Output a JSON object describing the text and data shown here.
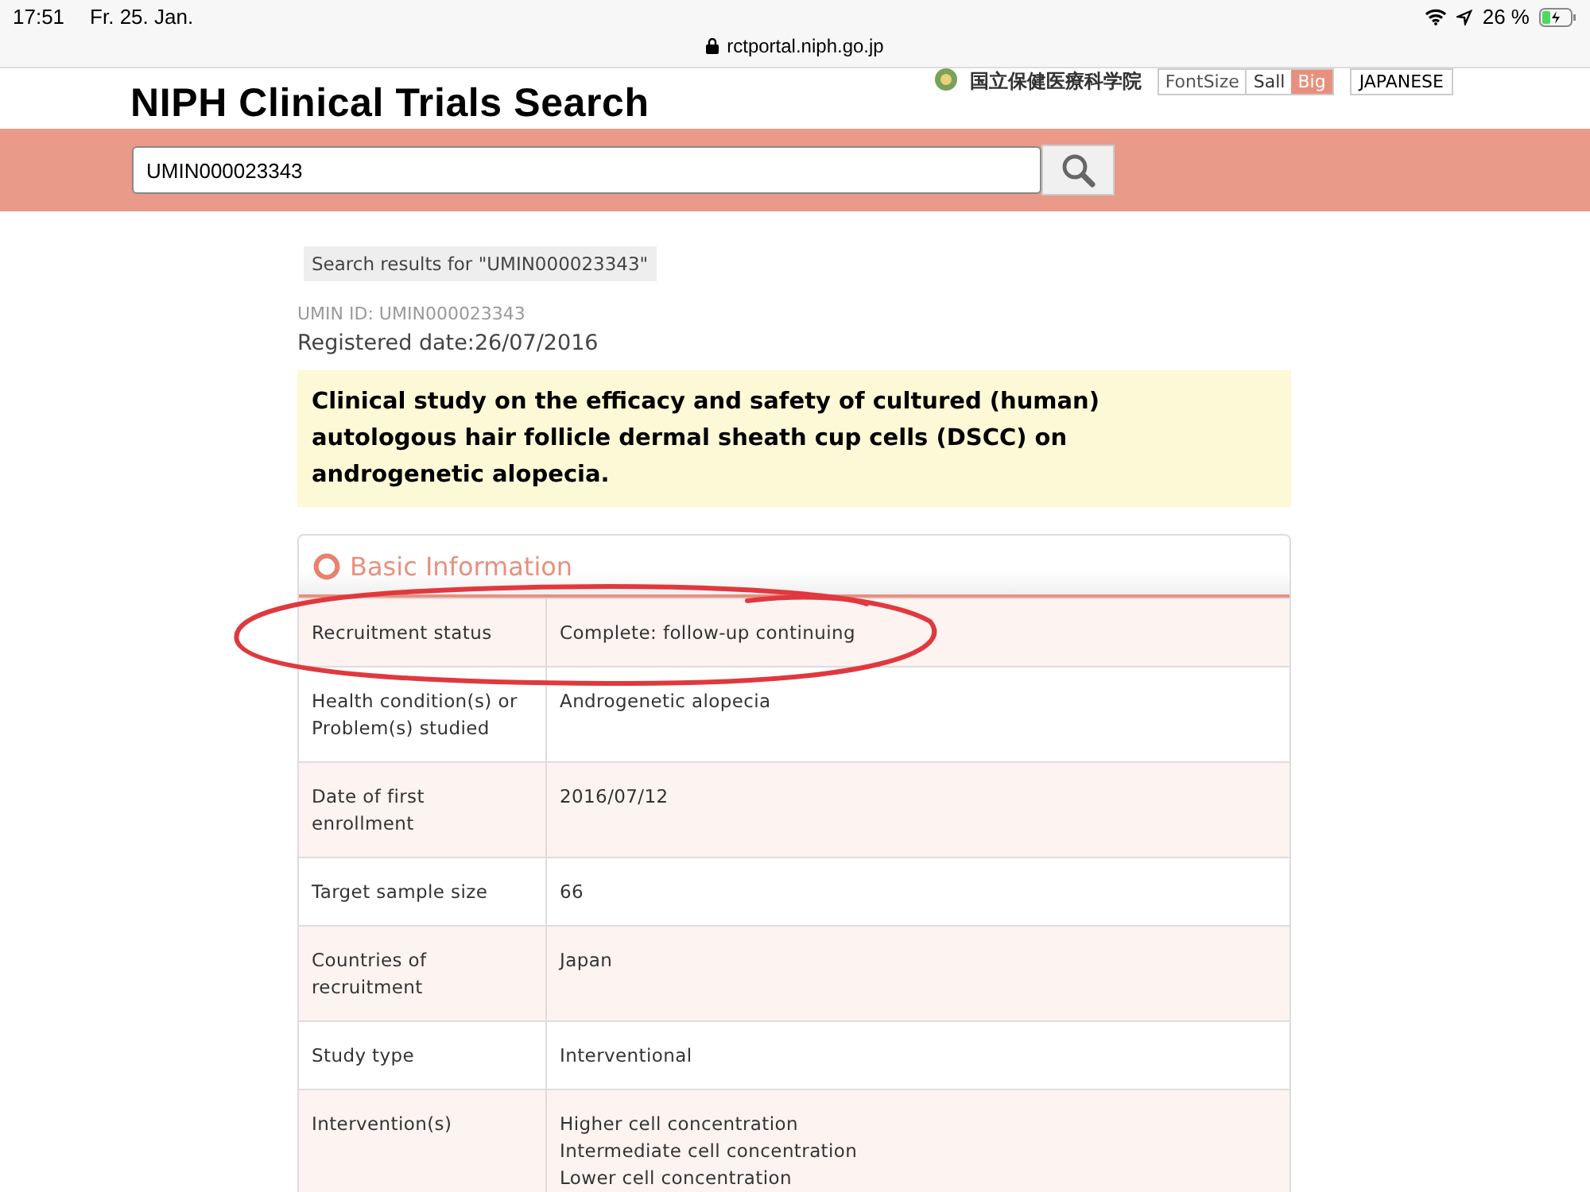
{
  "status_bar": {
    "time": "17:51",
    "date": "Fr. 25. Jan.",
    "battery": "26 %"
  },
  "browser": {
    "url": "rctportal.niph.go.jp"
  },
  "header": {
    "title": "NIPH Clinical Trials Search",
    "institute": "国立保健医療科学院",
    "font_size_label": "FontSize",
    "font_sizes": [
      {
        "label": "Sall",
        "selected": false
      },
      {
        "label": "Big",
        "selected": true
      }
    ],
    "language_button": "JAPANESE"
  },
  "search": {
    "value": "UMIN000023343"
  },
  "results_label": "Search results for \"UMIN000023343\"",
  "umin_id": "UMIN ID: UMIN000023343",
  "registered": "Registered date:26/07/2016",
  "study_title": "Clinical study on the efficacy and safety of cultured (human) autologous hair follicle dermal sheath cup cells (DSCC) on androgenetic alopecia.",
  "section": {
    "title": "Basic Information",
    "rows": [
      {
        "label": "Recruitment status",
        "value": [
          "Complete: follow-up continuing"
        ]
      },
      {
        "label": "Health condition(s) or Problem(s) studied",
        "value": [
          "Androgenetic alopecia"
        ]
      },
      {
        "label": "Date of first enrollment",
        "value": [
          "2016/07/12"
        ]
      },
      {
        "label": "Target sample size",
        "value": [
          "66"
        ]
      },
      {
        "label": "Countries of recruitment",
        "value": [
          "Japan"
        ]
      },
      {
        "label": "Study type",
        "value": [
          "Interventional"
        ]
      },
      {
        "label": "Intervention(s)",
        "value": [
          "Higher cell concentration",
          "Intermediate cell concentration",
          "Lower cell concentration"
        ]
      }
    ]
  }
}
